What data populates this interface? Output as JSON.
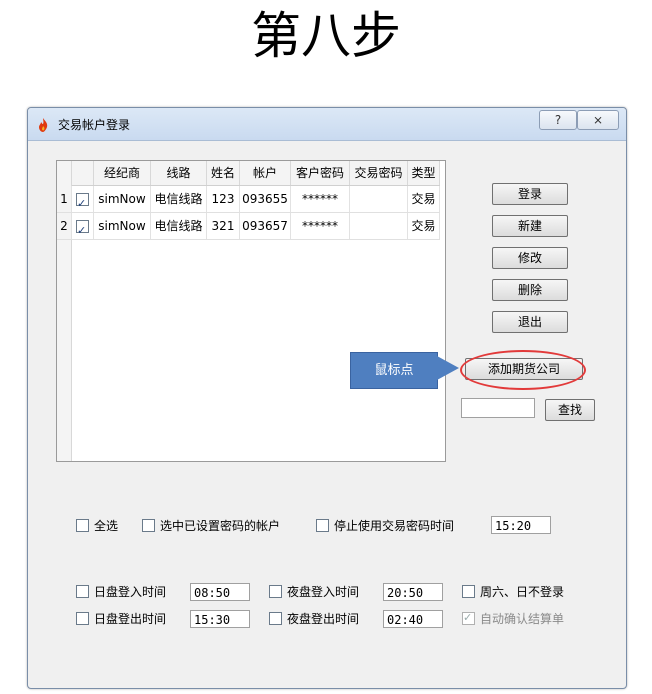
{
  "heading": "第八步",
  "window": {
    "title": "交易帐户登录",
    "help": "?",
    "close": "⨯"
  },
  "grid": {
    "columns": [
      "",
      "",
      "经纪商",
      "线路",
      "姓名",
      "帐户",
      "客户密码",
      "交易密码",
      "类型"
    ],
    "rows": [
      {
        "num": "1",
        "checked": true,
        "broker": "simNow",
        "line": "电信线路",
        "name": "123",
        "account": "093655",
        "password": "******",
        "trade_password": "",
        "type": "交易"
      },
      {
        "num": "2",
        "checked": true,
        "broker": "simNow",
        "line": "电信线路",
        "name": "321",
        "account": "093657",
        "password": "******",
        "trade_password": "",
        "type": "交易"
      }
    ]
  },
  "buttons": {
    "login": "登录",
    "new": "新建",
    "edit": "修改",
    "delete": "删除",
    "exit": "退出",
    "add_broker": "添加期货公司",
    "find": "查找"
  },
  "find_input": "",
  "callout": "鼠标点",
  "options": {
    "select_all": "全选",
    "select_with_password": "选中已设置密码的帐户",
    "stop_trade_password_time": "停止使用交易密码时间",
    "stop_time_value": "15:20",
    "day_login_time": "日盘登入时间",
    "day_login_value": "08:50",
    "night_login_time": "夜盘登入时间",
    "night_login_value": "20:50",
    "weekend_no_login": "周六、日不登录",
    "day_logout_time": "日盘登出时间",
    "day_logout_value": "15:30",
    "night_logout_time": "夜盘登出时间",
    "night_logout_value": "02:40",
    "auto_confirm": "自动确认结算单"
  },
  "colors": {
    "callout": "#4f7fc0",
    "highlight_oval": "#e23a3a"
  }
}
